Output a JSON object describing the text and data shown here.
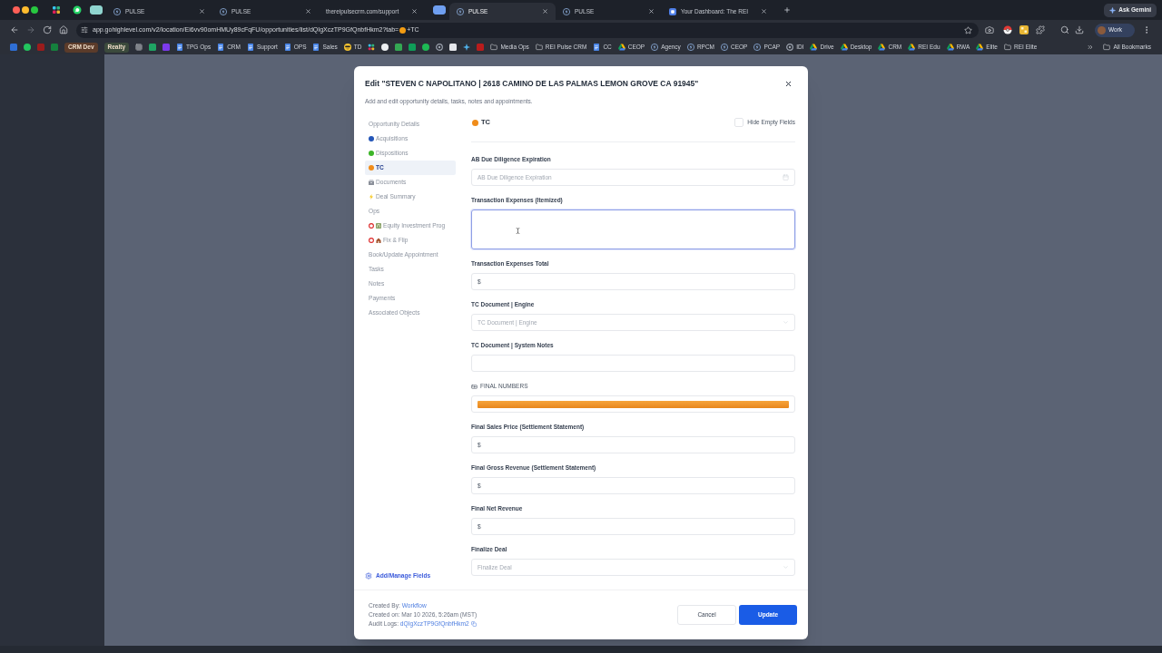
{
  "browser": {
    "tabs": [
      {
        "kind": "pinwheel",
        "selected": false
      },
      {
        "kind": "chat",
        "selected": false
      },
      {
        "kind": "group",
        "color": "#8fd5cf",
        "selected": false
      },
      {
        "kind": "pulse",
        "title": "PULSE",
        "selected": false
      },
      {
        "kind": "pulse",
        "title": "PULSE",
        "selected": false
      },
      {
        "kind": "site",
        "title": "thereipulsecrm.com/support",
        "selected": false
      },
      {
        "kind": "group",
        "color": "#6f9ff0",
        "selected": false
      },
      {
        "kind": "pulse",
        "title": "PULSE",
        "selected": true
      },
      {
        "kind": "pulse",
        "title": "PULSE",
        "selected": false
      },
      {
        "kind": "dashboard",
        "title": "Your Dashboard: The REI",
        "selected": false
      }
    ],
    "ask_button": "Ask Gemini",
    "address_bar": {
      "url": "app.gohighlevel.com/v2/location/Ei6vv90omHMUy89cFqFU/opportunities/list/dQIgXczTP9GfQnbfHkm2?tab=",
      "url_end": "+TC"
    },
    "profile": "Work",
    "bookmarks": [
      {
        "kind": "app",
        "color": "#2f6fd6"
      },
      {
        "kind": "dot",
        "color": "#22c55e"
      },
      {
        "kind": "app",
        "color": "#9b1c1c"
      },
      {
        "kind": "app",
        "color": "#15803d"
      },
      {
        "kind": "chip",
        "label": "CRM Dev",
        "color": "#5b3b2a"
      },
      {
        "kind": "chip",
        "label": "Realty",
        "color": "#3b4a3c"
      },
      {
        "kind": "grid"
      },
      {
        "kind": "app",
        "color": "#1fa463"
      },
      {
        "kind": "app",
        "color": "#7c3aed"
      },
      {
        "kind": "doc",
        "label": "TPG Ops"
      },
      {
        "kind": "doc",
        "label": "CRM"
      },
      {
        "kind": "doc",
        "label": "Support"
      },
      {
        "kind": "doc",
        "label": "OPS"
      },
      {
        "kind": "doc",
        "label": "Sales"
      },
      {
        "kind": "emoji",
        "label": "TD"
      },
      {
        "kind": "pinwheel"
      },
      {
        "kind": "dot",
        "color": "#eceff1"
      },
      {
        "kind": "app",
        "color": "#34a853"
      },
      {
        "kind": "app",
        "color": "#0f9d58"
      },
      {
        "kind": "dot",
        "color": "#1db954"
      },
      {
        "kind": "ring"
      },
      {
        "kind": "app",
        "color": "#e5e7eb"
      },
      {
        "kind": "sparkle"
      },
      {
        "kind": "app",
        "color": "#b91c1c"
      },
      {
        "kind": "folder",
        "label": "Media Ops"
      },
      {
        "kind": "folder",
        "label": "REI Pulse CRM"
      },
      {
        "kind": "doc",
        "label": "CC"
      },
      {
        "kind": "drive",
        "label": "CEOP"
      },
      {
        "kind": "bolt",
        "label": "Agency"
      },
      {
        "kind": "bolt",
        "label": "RPCM"
      },
      {
        "kind": "bolt",
        "label": "CEOP"
      },
      {
        "kind": "bolt",
        "label": "PCAP"
      },
      {
        "kind": "ring",
        "label": "IDI"
      },
      {
        "kind": "drive",
        "label": "Drive"
      },
      {
        "kind": "drive",
        "label": "Desktop"
      },
      {
        "kind": "drive",
        "label": "CRM"
      },
      {
        "kind": "drive",
        "label": "REI Edu"
      },
      {
        "kind": "drive",
        "label": "RWA"
      },
      {
        "kind": "drive",
        "label": "Elite"
      },
      {
        "kind": "folder",
        "label": "REI Elite"
      }
    ],
    "all_bookmarks": "All Bookmarks"
  },
  "modal": {
    "title": "Edit \"STEVEN C NAPOLITANO | 2618 CAMINO DE LAS PALMAS LEMON GROVE CA 91945\"",
    "subtitle": "Add and edit opportunity details, tasks, notes and appointments.",
    "nav": [
      {
        "kind": "plain",
        "label": "Opportunity Details",
        "selected": false
      },
      {
        "kind": "dot",
        "label": "Acquisitions",
        "color": "#2456b8",
        "selected": false
      },
      {
        "kind": "dot",
        "label": "Dispositions",
        "color": "#3cb528",
        "selected": false
      },
      {
        "kind": "dot",
        "label": "TC",
        "color": "#f08c1a",
        "selected": true
      },
      {
        "kind": "files",
        "label": "Documents",
        "selected": false
      },
      {
        "kind": "bolt",
        "label": "Deal Summary",
        "selected": false
      },
      {
        "kind": "plain",
        "label": "Ops",
        "selected": false
      },
      {
        "kind": "ring-bank",
        "label": "Equity Investment Prog",
        "selected": false
      },
      {
        "kind": "ring-house",
        "label": "Fix & Flip",
        "selected": false
      },
      {
        "kind": "plain",
        "label": "Book/Update Appointment",
        "selected": false
      },
      {
        "kind": "plain",
        "label": "Tasks",
        "selected": false
      },
      {
        "kind": "plain",
        "label": "Notes",
        "selected": false
      },
      {
        "kind": "plain",
        "label": "Payments",
        "selected": false
      },
      {
        "kind": "plain",
        "label": "Associated Objects",
        "selected": false
      }
    ],
    "manage_fields": "Add/Manage Fields",
    "section": {
      "title": "TC",
      "color": "#f08c1a"
    },
    "hide_empty": {
      "label": "Hide Empty Fields",
      "checked": false
    },
    "fields": [
      {
        "kind": "date",
        "label": "AB Due Diligence Expiration",
        "placeholder": "AB Due Diligence Expiration"
      },
      {
        "kind": "textarea",
        "label": "Transaction Expenses (Itemized)",
        "focused": true
      },
      {
        "kind": "currency",
        "label": "Transaction Expenses Total",
        "prefix": "$"
      },
      {
        "kind": "select",
        "label": "TC Document | Engine",
        "placeholder": "TC Document | Engine"
      },
      {
        "kind": "text",
        "label": "TC Document | System Notes"
      },
      {
        "kind": "banner",
        "label": "FINAL NUMBERS"
      },
      {
        "kind": "currency",
        "label": "Final Sales Price (Settlement Statement)",
        "prefix": "$"
      },
      {
        "kind": "currency",
        "label": "Final Gross Revenue (Settlement Statement)",
        "prefix": "$"
      },
      {
        "kind": "currency",
        "label": "Final Net Revenue",
        "prefix": "$"
      },
      {
        "kind": "select",
        "label": "Finalize Deal",
        "placeholder": "Finalize Deal"
      }
    ],
    "footer": {
      "created_by": {
        "label": "Created By:",
        "link": "Workflow"
      },
      "created_on": "Created on: Mar 10 2026, 5:26am (MST)",
      "audit_logs": {
        "label": "Audit Logs:",
        "link": "dQIgXczTP9GfQnbfHkm2"
      }
    },
    "buttons": [
      {
        "kind": "secondary",
        "label": "Cancel"
      },
      {
        "kind": "primary",
        "label": "Update"
      }
    ]
  }
}
